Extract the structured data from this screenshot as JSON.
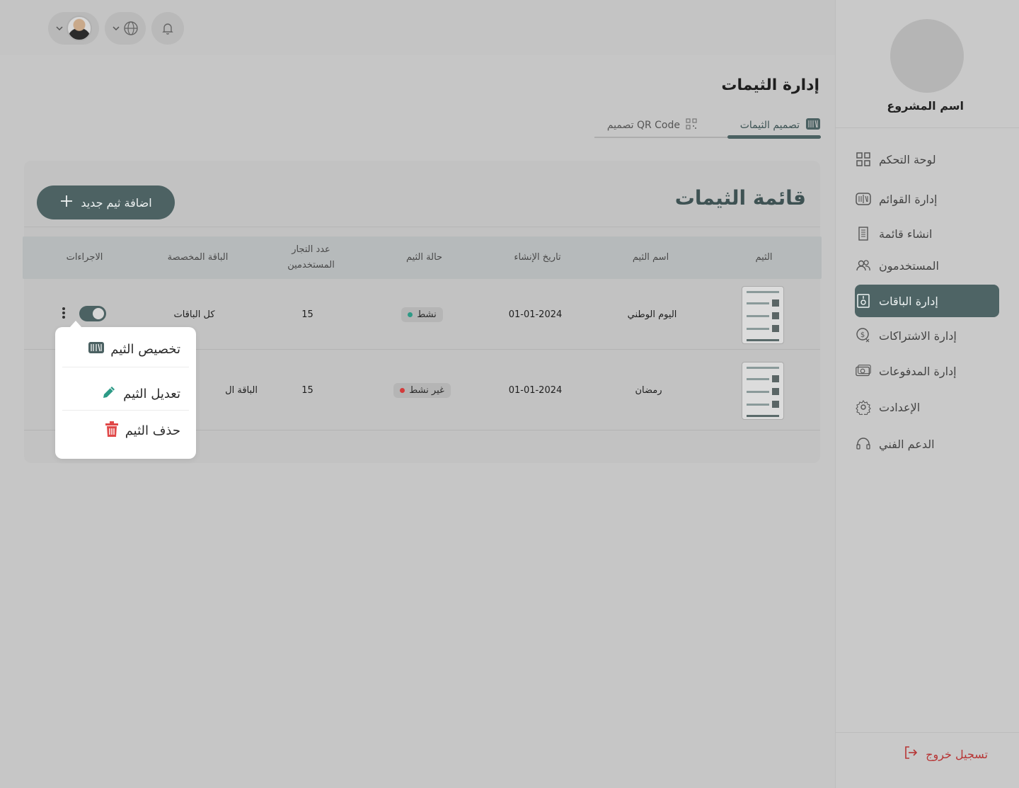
{
  "topbar": {
    "avatar_label": "user-avatar",
    "language_label": "language",
    "notifications_label": "notifications"
  },
  "sidebar": {
    "project_name": "اسم المشروع",
    "items": [
      {
        "label": "لوحة التحكم",
        "icon": "grid-icon",
        "active": false
      },
      {
        "label": "إدارة القوائم",
        "icon": "menu-book-icon",
        "active": false
      },
      {
        "label": "انشاء قائمة",
        "icon": "document-icon",
        "active": false
      },
      {
        "label": "المستخدمون",
        "icon": "users-icon",
        "active": false
      },
      {
        "label": "إدارة الباقات",
        "icon": "package-icon",
        "active": true
      },
      {
        "label": "إدارة الاشتراكات",
        "icon": "subscription-icon",
        "active": false
      },
      {
        "label": "إدارة المدفوعات",
        "icon": "payments-icon",
        "active": false
      },
      {
        "label": "الإعدادت",
        "icon": "gear-icon",
        "active": false
      },
      {
        "label": "الدعم الفني",
        "icon": "headset-icon",
        "active": false
      }
    ],
    "logout_label": "تسجيل خروج"
  },
  "header": {
    "title": "إدارة الثيمات",
    "tabs": [
      {
        "label": "تصميم الثيمات",
        "active": true
      },
      {
        "label": "تصميم QR Code",
        "active": false
      }
    ]
  },
  "card": {
    "title": "قائمة الثيمات",
    "add_button": "اضافة ثيم جديد",
    "columns": {
      "theme": "الثيم",
      "name": "اسم الثيم",
      "created": "تاريخ الإنشاء",
      "status": "حالة الثيم",
      "merchants_line1": "عدد التجار",
      "merchants_line2": "المستخدمين",
      "package": "الباقة المخصصة",
      "actions": "الاجراءات"
    },
    "rows": [
      {
        "name": "اليوم الوطني",
        "created": "01-01-2024",
        "status": "نشط",
        "merchants": "15",
        "package": "كل الباقات"
      },
      {
        "name": "رمضان",
        "created": "01-01-2024",
        "status": "غير نشط",
        "merchants": "15",
        "package": "الباقة ال"
      }
    ]
  },
  "popup": {
    "customize": "تخصيص الثيم",
    "edit": "تعديل الثيم",
    "delete": "حذف الثيم"
  },
  "colors": {
    "accent": "#4e6465",
    "active_dot": "#2e9a86",
    "inactive_dot": "#d33b3b",
    "danger": "#e04848",
    "edit": "#2c9a86",
    "logout": "#b73535"
  }
}
